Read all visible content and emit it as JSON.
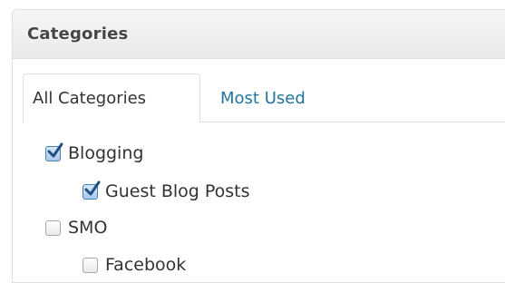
{
  "panel": {
    "title": "Categories"
  },
  "tabs": [
    {
      "label": "All Categories",
      "active": true
    },
    {
      "label": "Most Used",
      "active": false
    }
  ],
  "categories": [
    {
      "label": "Blogging",
      "checked": true,
      "level": 0
    },
    {
      "label": "Guest Blog Posts",
      "checked": true,
      "level": 1
    },
    {
      "label": "SMO",
      "checked": false,
      "level": 0
    },
    {
      "label": "Facebook",
      "checked": false,
      "level": 1
    }
  ],
  "colors": {
    "link": "#21759b",
    "text": "#333333",
    "border": "#dfdfdf",
    "header_bg": "#eeeeee",
    "checkbox_checked": "#4a7fb6"
  },
  "icons": {
    "checked": "check-icon"
  }
}
